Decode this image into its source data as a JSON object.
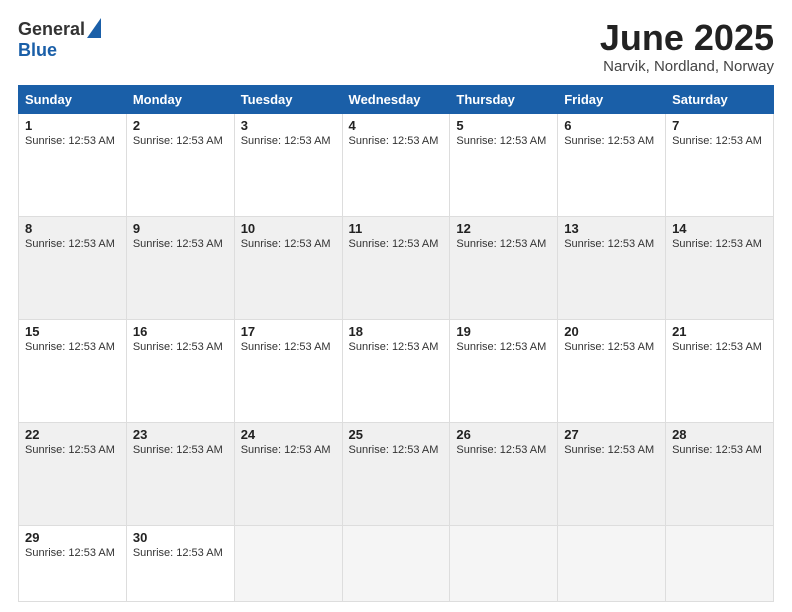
{
  "header": {
    "logo_line1": "General",
    "logo_line2": "Blue",
    "month_title": "June 2025",
    "location": "Narvik, Nordland, Norway"
  },
  "weekdays": [
    "Sunday",
    "Monday",
    "Tuesday",
    "Wednesday",
    "Thursday",
    "Friday",
    "Saturday"
  ],
  "sunrise_text": "Sunrise: 12:53 AM",
  "weeks": [
    [
      {
        "day": "1",
        "empty": false
      },
      {
        "day": "2",
        "empty": false
      },
      {
        "day": "3",
        "empty": false
      },
      {
        "day": "4",
        "empty": false
      },
      {
        "day": "5",
        "empty": false
      },
      {
        "day": "6",
        "empty": false
      },
      {
        "day": "7",
        "empty": false
      }
    ],
    [
      {
        "day": "8",
        "empty": false
      },
      {
        "day": "9",
        "empty": false
      },
      {
        "day": "10",
        "empty": false
      },
      {
        "day": "11",
        "empty": false
      },
      {
        "day": "12",
        "empty": false
      },
      {
        "day": "13",
        "empty": false
      },
      {
        "day": "14",
        "empty": false
      }
    ],
    [
      {
        "day": "15",
        "empty": false
      },
      {
        "day": "16",
        "empty": false
      },
      {
        "day": "17",
        "empty": false
      },
      {
        "day": "18",
        "empty": false
      },
      {
        "day": "19",
        "empty": false
      },
      {
        "day": "20",
        "empty": false
      },
      {
        "day": "21",
        "empty": false
      }
    ],
    [
      {
        "day": "22",
        "empty": false
      },
      {
        "day": "23",
        "empty": false
      },
      {
        "day": "24",
        "empty": false
      },
      {
        "day": "25",
        "empty": false
      },
      {
        "day": "26",
        "empty": false
      },
      {
        "day": "27",
        "empty": false
      },
      {
        "day": "28",
        "empty": false
      }
    ],
    [
      {
        "day": "29",
        "empty": false
      },
      {
        "day": "30",
        "empty": false
      },
      {
        "day": "",
        "empty": true
      },
      {
        "day": "",
        "empty": true
      },
      {
        "day": "",
        "empty": true
      },
      {
        "day": "",
        "empty": true
      },
      {
        "day": "",
        "empty": true
      }
    ]
  ]
}
